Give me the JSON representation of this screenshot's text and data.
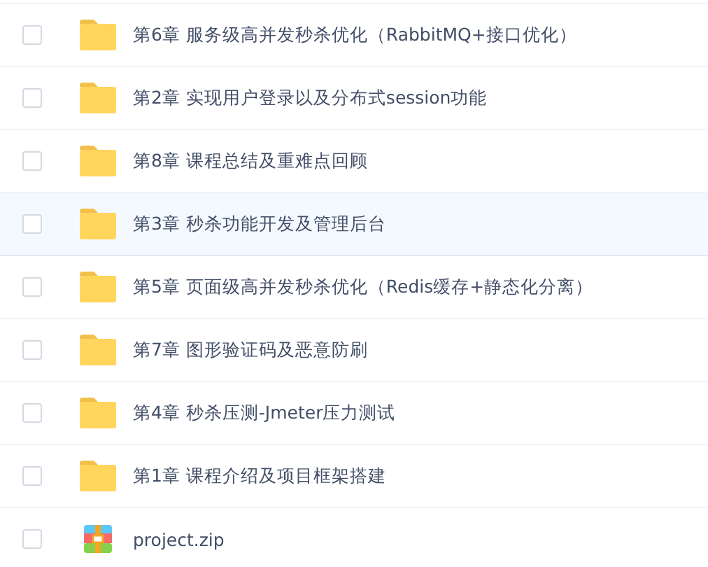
{
  "files": [
    {
      "kind": "folder",
      "name": "第6章 服务级高并发秒杀优化（RabbitMQ+接口优化）",
      "checked": false,
      "hovered": false
    },
    {
      "kind": "folder",
      "name": "第2章 实现用户登录以及分布式session功能",
      "checked": false,
      "hovered": false
    },
    {
      "kind": "folder",
      "name": "第8章 课程总结及重难点回顾",
      "checked": false,
      "hovered": false
    },
    {
      "kind": "folder",
      "name": "第3章 秒杀功能开发及管理后台",
      "checked": false,
      "hovered": true
    },
    {
      "kind": "folder",
      "name": "第5章 页面级高并发秒杀优化（Redis缓存+静态化分离）",
      "checked": false,
      "hovered": false
    },
    {
      "kind": "folder",
      "name": "第7章 图形验证码及恶意防刷",
      "checked": false,
      "hovered": false
    },
    {
      "kind": "folder",
      "name": "第4章 秒杀压测-Jmeter压力测试",
      "checked": false,
      "hovered": false
    },
    {
      "kind": "folder",
      "name": "第1章 课程介绍及项目框架搭建",
      "checked": false,
      "hovered": false
    },
    {
      "kind": "zip",
      "name": "project.zip",
      "checked": false,
      "hovered": false
    }
  ]
}
